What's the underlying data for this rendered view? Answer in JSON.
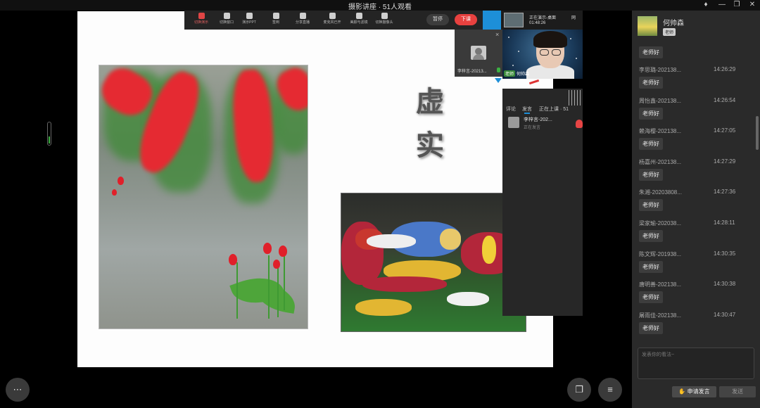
{
  "window": {
    "title": "摄影讲座 · 51人观看",
    "controls": [
      "bell-icon",
      "minimize-icon",
      "restore-icon",
      "close-icon"
    ]
  },
  "toolbar": {
    "items": [
      {
        "label": "切换演示",
        "icon": "screen-share-icon",
        "active": true
      },
      {
        "label": "切换窗口",
        "icon": "window-icon"
      },
      {
        "label": "演示PPT",
        "icon": "ppt-icon"
      },
      {
        "label": "签到",
        "icon": "checkin-icon"
      },
      {
        "label": "分享直播",
        "icon": "share-icon"
      },
      {
        "label": "麦克风已开",
        "icon": "microphone-icon"
      },
      {
        "label": "美颜与滤镜",
        "icon": "beauty-icon"
      },
      {
        "label": "切换摄像头",
        "icon": "camera-icon"
      }
    ],
    "pause_label": "暂停",
    "end_label": "下课"
  },
  "presentation": {
    "thumb_status": "正在演示-桌面",
    "thumb_time": "01:48:26",
    "net": "网",
    "calligraphy": [
      "虚",
      "实"
    ]
  },
  "video": {
    "student_name": "李梓言-20213...",
    "teacher_tag": "老师",
    "teacher_name": "何帅森"
  },
  "side_panel": {
    "tabs": [
      "评论",
      "发言",
      "正在上课 · 51"
    ],
    "speaker_name": "李梓言-202...",
    "speaker_status": "正在发言"
  },
  "chat": {
    "host_name": "何帅森",
    "host_tag": "老师",
    "first_message": "老师好",
    "messages": [
      {
        "name": "李思璐-202138...",
        "time": "14:26:29",
        "text": "老师好"
      },
      {
        "name": "周怡鑫-202138...",
        "time": "14:26:54",
        "text": "老师好"
      },
      {
        "name": "赖海樱-202138...",
        "time": "14:27:05",
        "text": "老师好"
      },
      {
        "name": "杨嘉州-202138...",
        "time": "14:27:29",
        "text": "老师好"
      },
      {
        "name": "朱湘-20203808...",
        "time": "14:27:36",
        "text": "老师好"
      },
      {
        "name": "梁家瑜-202038...",
        "time": "14:28:11",
        "text": "老师好"
      },
      {
        "name": "陈文辉-201938...",
        "time": "14:30:35",
        "text": "老师好"
      },
      {
        "name": "唐明善-202138...",
        "time": "14:30:38",
        "text": "老师好"
      },
      {
        "name": "屠雨佳-202138...",
        "time": "14:30:47",
        "text": "老师好"
      }
    ],
    "input_placeholder": "发表你的看法~",
    "apply_label": "申请发言",
    "send_label": "发送"
  },
  "colors": {
    "accent_blue": "#1d8fd8",
    "end_red": "#e8413f",
    "panel_dark": "#2a2a2a"
  }
}
